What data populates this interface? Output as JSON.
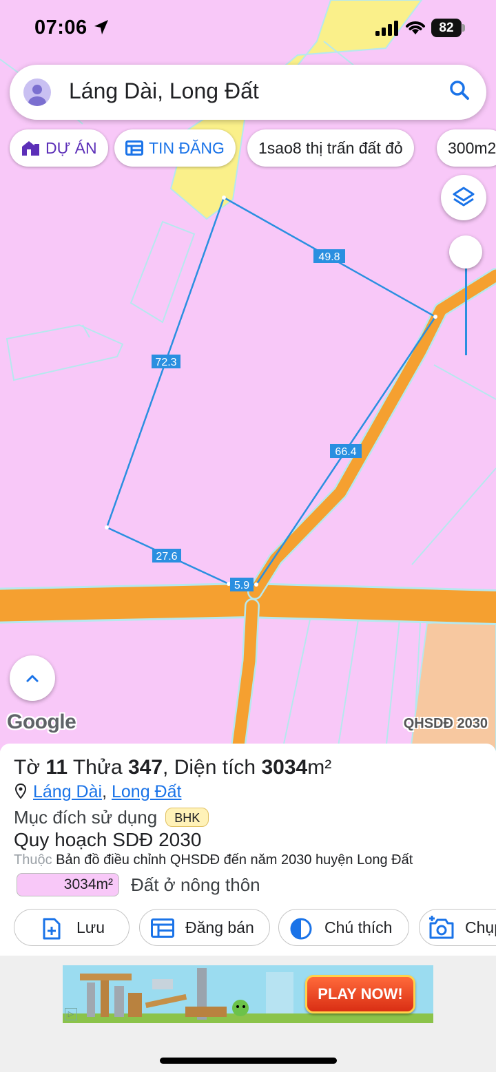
{
  "status_bar": {
    "time": "07:06",
    "battery": "82"
  },
  "search": {
    "query": "Láng Dài, Long Đất"
  },
  "chips": [
    {
      "label": "DỰ ÁN",
      "icon": "house-icon"
    },
    {
      "label": "TIN ĐĂNG",
      "icon": "listing-icon"
    },
    {
      "label": "1sao8 thị trấn đất đỏ"
    },
    {
      "label": "300m2"
    }
  ],
  "map": {
    "edge_labels": [
      "49.8",
      "72.3",
      "66.4",
      "27.6",
      "5.9"
    ],
    "google_logo": "Google",
    "badge": "QHSDĐ 2030",
    "colors": {
      "residential_land": "#f8c8f8",
      "road": "#f5a030",
      "commercial_strip": "#faf08a",
      "boundary": "#2a8fe0"
    }
  },
  "panel": {
    "title_prefix_1": "Tờ",
    "sheet_no": "11",
    "title_prefix_2": "Thửa",
    "plot_no": "347",
    "title_prefix_3": ", Diện tích",
    "area": "3034",
    "area_unit": "m²",
    "address_part1": "Láng Dài",
    "address_sep": ",",
    "address_part2": "Long Đất",
    "purpose_label": "Mục đích sử dụng",
    "purpose_code": "BHK",
    "plan_title": "Quy hoạch SDĐ 2030",
    "belongs_label": "Thuộc",
    "belongs_text": "Bản đồ điều chỉnh QHSDĐ đến năm 2030 huyện Long Đất",
    "legend_area": "3034m²",
    "legend_label": "Đất ở nông thôn"
  },
  "actions": [
    {
      "label": "Lưu",
      "icon": "add-file-icon"
    },
    {
      "label": "Đăng bán",
      "icon": "listing-icon"
    },
    {
      "label": "Chú thích",
      "icon": "contrast-icon"
    },
    {
      "label": "Chụp",
      "icon": "camera-icon"
    }
  ],
  "ad": {
    "cta": "PLAY NOW!"
  }
}
